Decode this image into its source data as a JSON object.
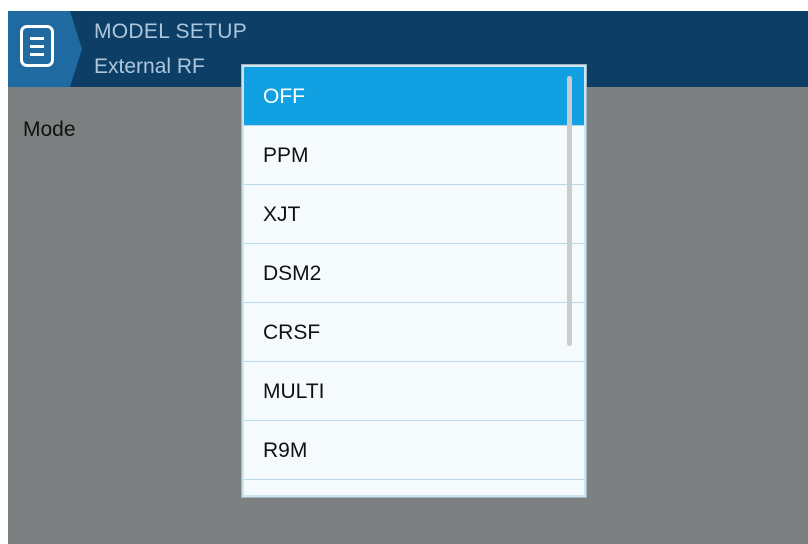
{
  "header": {
    "title": "MODEL SETUP",
    "subtitle": "External RF",
    "menu_icon": "menu-icon"
  },
  "field": {
    "label": "Mode"
  },
  "dropdown": {
    "selected": "OFF",
    "options": [
      "OFF",
      "PPM",
      "XJT",
      "DSM2",
      "CRSF",
      "MULTI",
      "R9M"
    ]
  },
  "colors": {
    "header_bg": "#0d3e66",
    "menu_tab": "#1f6aa1",
    "screen_bg": "#7d8080",
    "selected_option": "#11a0e1",
    "dropdown_bg": "#f5fbfd"
  }
}
